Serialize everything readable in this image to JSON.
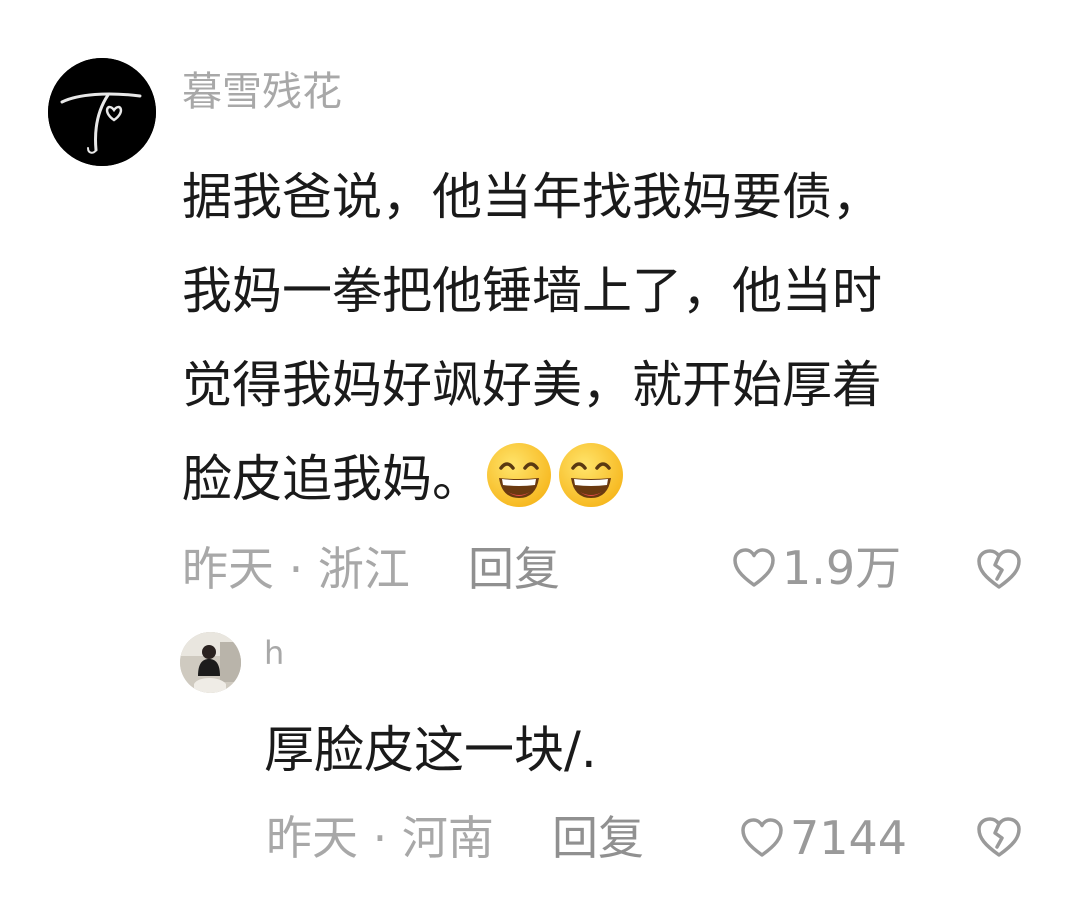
{
  "comment": {
    "username": "暮雪残花",
    "text_lines": [
      "据我爸说，他当年找我妈要债，",
      "我妈一拳把他锤墙上了，他当时",
      "觉得我妈好飒好美，就开始厚着",
      "脸皮追我妈。"
    ],
    "emojis": [
      "grinning-face-emoji",
      "grinning-face-emoji"
    ],
    "meta": "昨天 · 浙江",
    "reply_label": "回复",
    "like_count": "1.9万"
  },
  "reply": {
    "username": "h",
    "text": "厚脸皮这一块/.",
    "meta": "昨天 · 河南",
    "reply_label": "回复",
    "like_count": "7144"
  },
  "colors": {
    "meta_text": "#a8a8a8",
    "body_text": "#1a1a1a",
    "icon_gray": "#9a9a9a"
  }
}
